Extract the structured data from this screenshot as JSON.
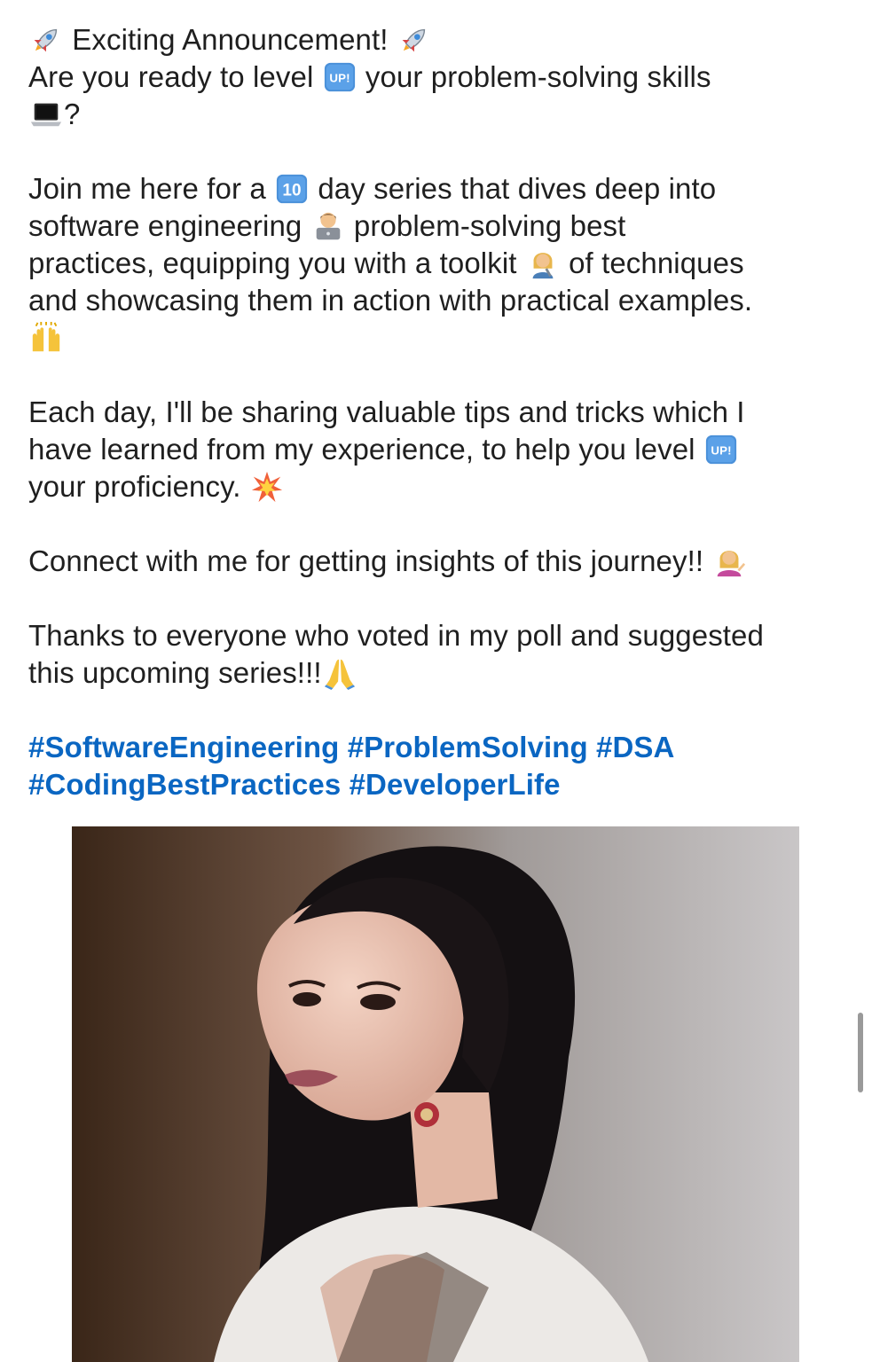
{
  "post": {
    "line1": {
      "pre": " Exciting Announcement! ",
      "emoji_a": "rocket-icon",
      "emoji_b": "rocket-icon"
    },
    "line2": {
      "pre": "Are you ready to level ",
      "post": " your problem-solving skills",
      "emoji": "up-button-icon",
      "emoji_text": "UP!"
    },
    "line3": {
      "post": "?",
      "emoji": "laptop-icon"
    },
    "para2": {
      "l1_pre": "Join me here for a ",
      "l1_badge": "10",
      "l1_post": " day series that dives deep into",
      "l2_pre": "software engineering ",
      "l2_post": " problem-solving best",
      "l3_pre": "practices, equipping you with a toolkit ",
      "l3_post": " of techniques",
      "l4": "and showcasing them in action with practical examples."
    },
    "para3": {
      "l1": "Each day, I'll be sharing valuable tips and tricks which I",
      "l2_pre": "have learned from my experience, to help you level ",
      "l2_emoji_text": "UP!",
      "l3_pre": "your proficiency. "
    },
    "para4": {
      "l1_pre": "Connect with me for getting insights of this journey!! "
    },
    "para5": {
      "l1": "Thanks to everyone who voted in my poll and suggested",
      "l2_pre": "this upcoming series!!!"
    },
    "hashtags": {
      "line1": [
        "#SoftwareEngineering",
        "#ProblemSolving",
        "#DSA"
      ],
      "line2": [
        "#CodingBestPractices",
        "#DeveloperLife"
      ]
    }
  },
  "image": {
    "name": "profile-photo"
  },
  "colors": {
    "text": "#1f1f1f",
    "hashtag": "#0a66c2",
    "badge": "#3b82c4"
  }
}
